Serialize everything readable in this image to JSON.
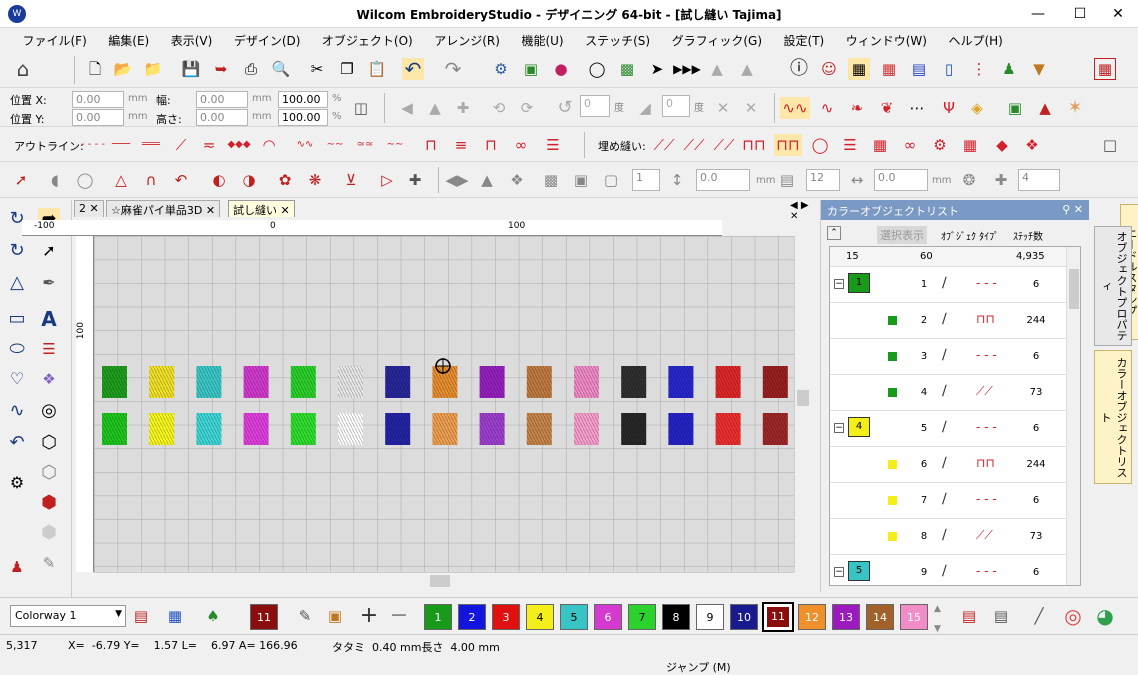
{
  "window": {
    "title": "Wilcom EmbroideryStudio - デザイニング 64-bit - [試し縫い     Tajima]"
  },
  "menu": [
    "ファイル(F)",
    "編集(E)",
    "表示(V)",
    "デザイン(D)",
    "オブジェクト(O)",
    "アレンジ(R)",
    "機能(U)",
    "ステッチ(S)",
    "グラフィック(G)",
    "設定(T)",
    "ウィンドウ(W)",
    "ヘルプ(H)"
  ],
  "position": {
    "x_label": "位置 X:",
    "y_label": "位置 Y:",
    "x": "0.00",
    "y": "0.00",
    "unit": "mm"
  },
  "size": {
    "w_label": "幅:",
    "h_label": "高さ:",
    "w": "0.00",
    "h": "0.00",
    "unit": "mm",
    "w_pct": "100.00",
    "h_pct": "100.00",
    "pct": "%"
  },
  "rotate": {
    "value1": "0",
    "value2": "0",
    "deg": "度"
  },
  "outline_label": "アウトライン:",
  "fill_label": "埋め縫い:",
  "tb4": {
    "v1": "1",
    "v2": "0.0",
    "unit": "mm",
    "v3": "12",
    "v4": "0.0",
    "v5": "4"
  },
  "tabs": [
    {
      "label": "2"
    },
    {
      "label": "☆麻雀パイ単品3D"
    },
    {
      "label": "試し縫い"
    }
  ],
  "ruler": {
    "h_m100": "-100",
    "h_0": "0",
    "h_100": "100",
    "v_100": "100"
  },
  "thread_colors": [
    "#1ea01e",
    "#f2e22a",
    "#3cc8c8",
    "#d43ad0",
    "#2cd22c",
    "#e8e8e8",
    "#28289c",
    "#e89030",
    "#9820c0",
    "#c07c40",
    "#f08cc8",
    "#303030",
    "#2828d0",
    "#e02828",
    "#9c2020"
  ],
  "thread_colors_b": [
    "#1ec81e",
    "#f8f820",
    "#40d8d8",
    "#e040e0",
    "#30e030",
    "#ffffff",
    "#2424a8",
    "#f0a050",
    "#a040d0",
    "#c8864a",
    "#f8a0d0",
    "#282828",
    "#2424c8",
    "#f03030",
    "#a02828"
  ],
  "panel": {
    "title": "カラーオブジェクトリスト",
    "select_btn": "選択表示",
    "col_obj": "ｵﾌﾞｼﾞｪｸ ﾀｲﾌﾟ",
    "col_cnt": "ｽﾃｯﾁ数",
    "summary": {
      "colors": "15",
      "objs": "60",
      "stitches": "4,935"
    },
    "rows": [
      {
        "group": "1",
        "color": "#1a9a1a",
        "num": "1",
        "count": "6",
        "kind": "run"
      },
      {
        "group": "",
        "color": "#1a9a1a",
        "num": "2",
        "count": "244",
        "kind": "fill"
      },
      {
        "group": "",
        "color": "#1a9a1a",
        "num": "3",
        "count": "6",
        "kind": "run"
      },
      {
        "group": "",
        "color": "#1a9a1a",
        "num": "4",
        "count": "73",
        "kind": "satin"
      },
      {
        "group": "4",
        "color": "#f4ef1a",
        "num": "5",
        "count": "6",
        "kind": "run"
      },
      {
        "group": "",
        "color": "#f4ef1a",
        "num": "6",
        "count": "244",
        "kind": "fill"
      },
      {
        "group": "",
        "color": "#f4ef1a",
        "num": "7",
        "count": "6",
        "kind": "run"
      },
      {
        "group": "",
        "color": "#f4ef1a",
        "num": "8",
        "count": "73",
        "kind": "satin"
      },
      {
        "group": "5",
        "color": "#38c4c4",
        "num": "9",
        "count": "6",
        "kind": "run"
      }
    ]
  },
  "vtabs": [
    "ニードルスタンプ",
    "オブジェクトプロパティ",
    "カラーオブジェクトリスト"
  ],
  "colorway": "Colorway 1",
  "current_color": "11",
  "palette": [
    {
      "n": "1",
      "c": "#1a9a1a"
    },
    {
      "n": "2",
      "c": "#1414e0"
    },
    {
      "n": "3",
      "c": "#e01010"
    },
    {
      "n": "4",
      "c": "#f4ef1a"
    },
    {
      "n": "5",
      "c": "#38c4c4"
    },
    {
      "n": "6",
      "c": "#d43ad0"
    },
    {
      "n": "7",
      "c": "#2cd22c"
    },
    {
      "n": "8",
      "c": "#000000"
    },
    {
      "n": "9",
      "c": "#ffffff"
    },
    {
      "n": "10",
      "c": "#1a1a90"
    },
    {
      "n": "11",
      "c": "#8a0e0e"
    },
    {
      "n": "12",
      "c": "#f0902a"
    },
    {
      "n": "13",
      "c": "#9a1ac0"
    },
    {
      "n": "14",
      "c": "#a0622a"
    },
    {
      "n": "15",
      "c": "#f08cc8"
    }
  ],
  "status": {
    "stitch": "5,317",
    "coords": "X=  -6.79 Y=    1.57 L=    6.97 A= 166.96",
    "tatami": "タタミ  0.40 mm長さ  4.00 mm",
    "jump": "ジャンプ (M)"
  }
}
